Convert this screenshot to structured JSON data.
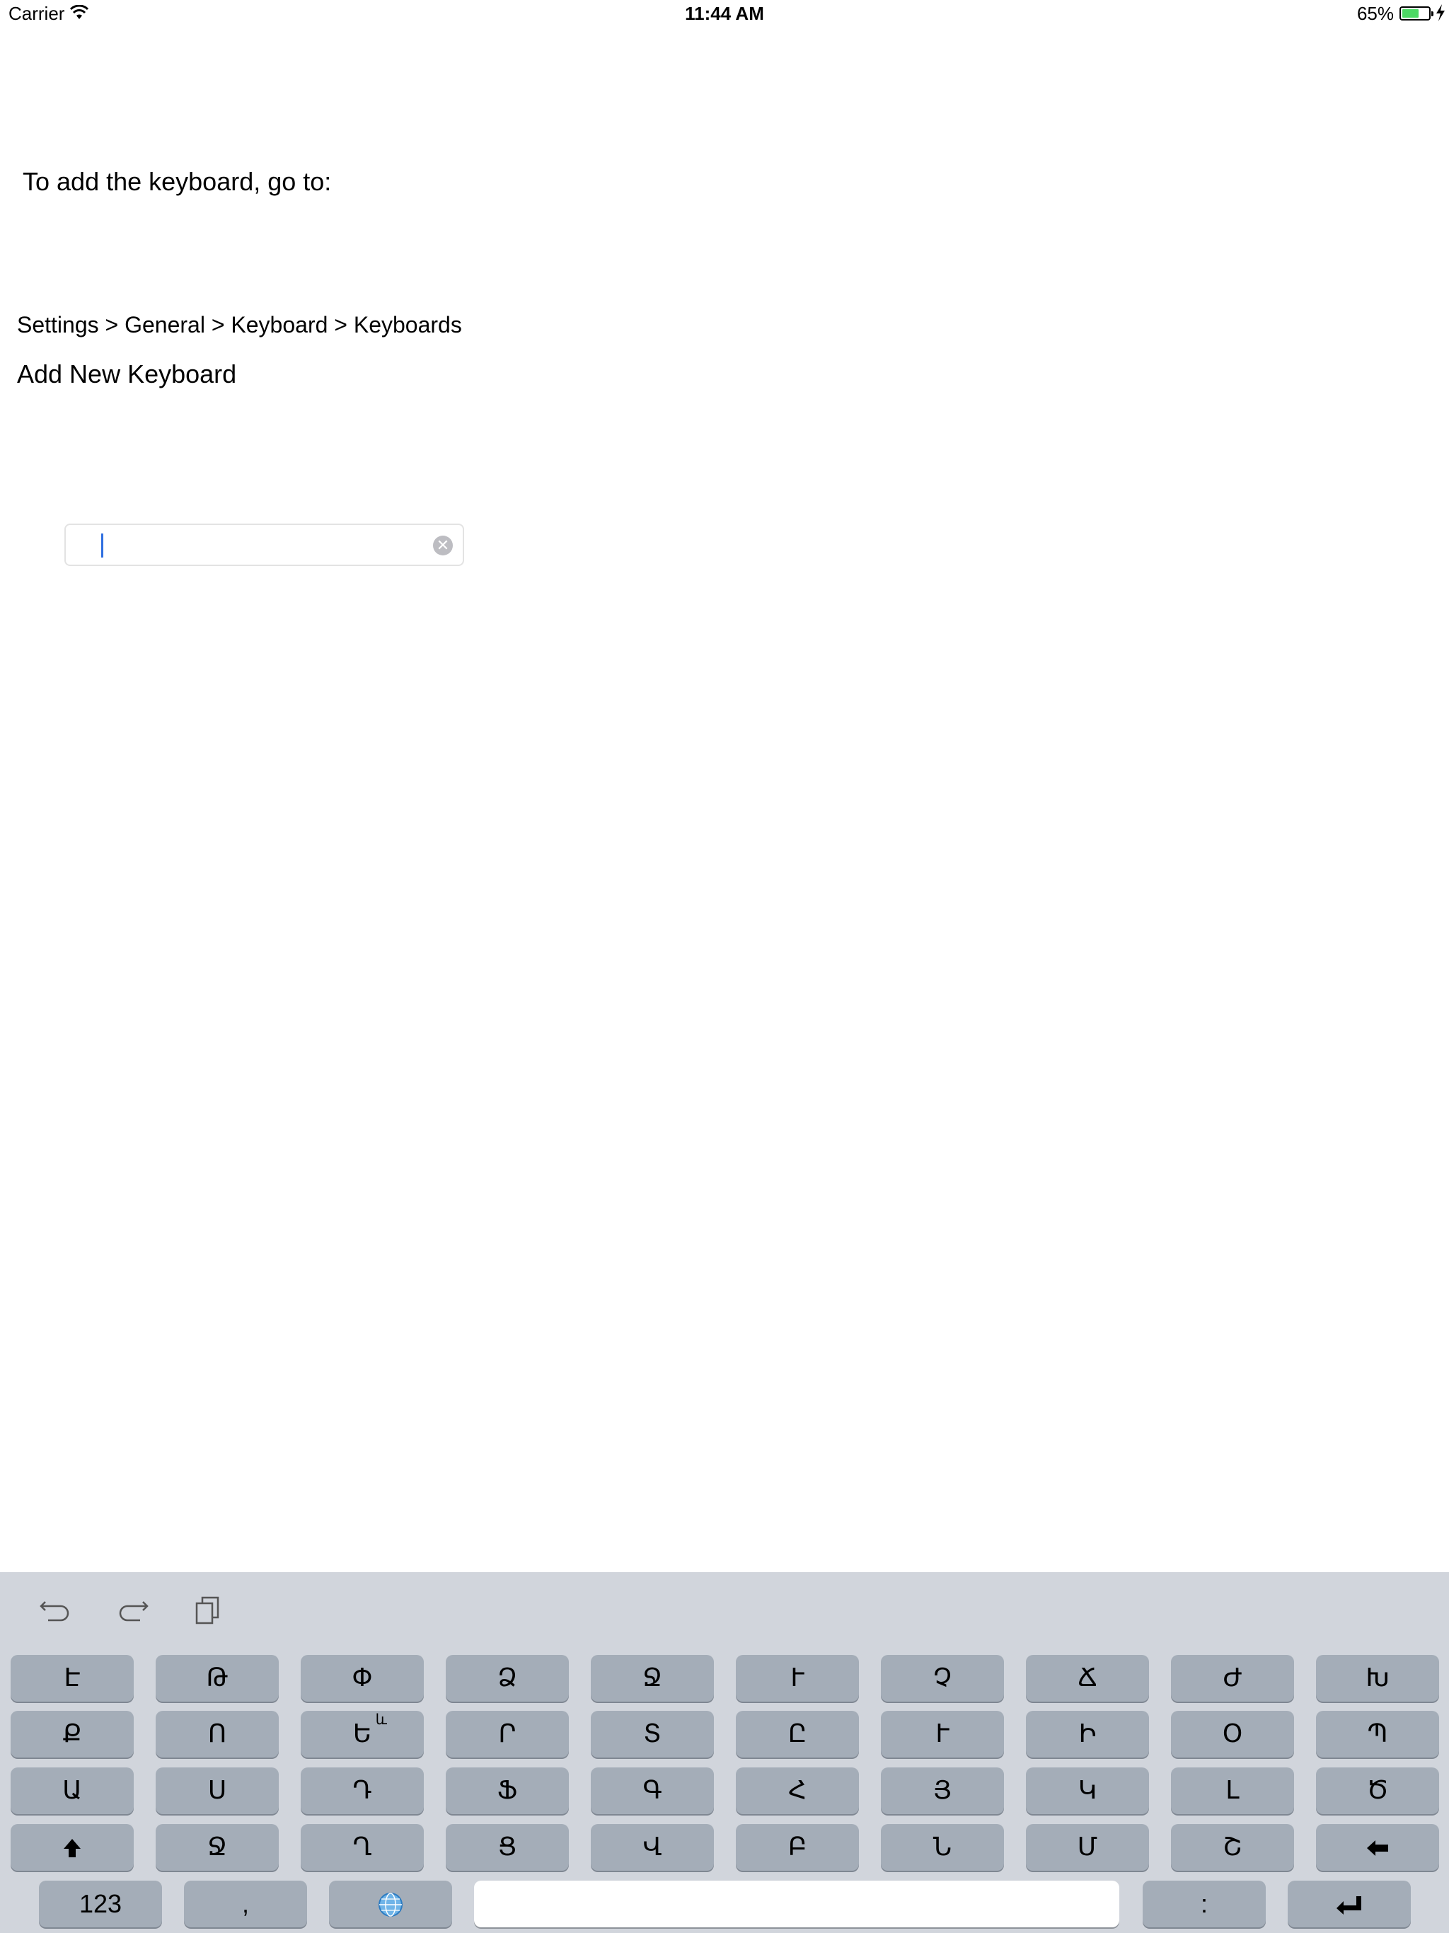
{
  "status_bar": {
    "carrier": "Carrier",
    "time": "11:44 AM",
    "battery_percent": "65%",
    "battery_level": 0.65
  },
  "content": {
    "instruction": "To add the keyboard, go to:",
    "settings_path": "Settings > General > Keyboard > Keyboards",
    "add_new_keyboard": "Add New Keyboard",
    "text_field": {
      "value": "",
      "clear_icon": "clear-icon"
    }
  },
  "keyboard": {
    "toolbar": [
      "undo-icon",
      "redo-icon",
      "paste-icon"
    ],
    "rows": [
      [
        "Է",
        "Թ",
        "Փ",
        "Ձ",
        "Ջ",
        "Ւ",
        "Չ",
        "Ճ",
        "Ժ",
        "Խ"
      ],
      [
        "Ք",
        "Ո",
        "Ե",
        "Ր",
        "Տ",
        "Ը",
        "Ւ",
        "Ի",
        "Օ",
        "Պ"
      ],
      [
        "Ա",
        "Ս",
        "Դ",
        "Ֆ",
        "Գ",
        "Հ",
        "Յ",
        "Կ",
        "Լ",
        "Ծ"
      ],
      [
        "Ջ",
        "Ղ",
        "Ց",
        "Վ",
        "Բ",
        "Ն",
        "Մ",
        "Շ"
      ]
    ],
    "row2_key3_alt": "և",
    "bottom_row": {
      "numbers": "123",
      "comma": ",",
      "colon": ":"
    },
    "icons": {
      "shift": "shift-icon",
      "backspace": "backspace-icon",
      "globe": "globe-icon",
      "return": "return-icon"
    }
  }
}
